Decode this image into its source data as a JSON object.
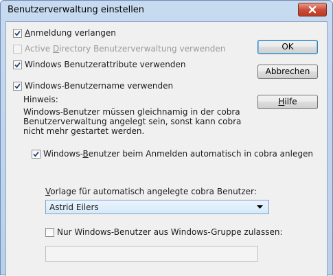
{
  "window": {
    "title": "Benutzerverwaltung einstellen"
  },
  "checkboxes": {
    "anmeldung": {
      "pre": "",
      "accel": "A",
      "post": "nmeldung verlangen",
      "checked": true
    },
    "active_directory": {
      "pre": "Active ",
      "accel": "D",
      "post": "irectory Benutzerverwaltung verwenden",
      "checked": false,
      "disabled": true
    },
    "attribute": {
      "label": "Windows Benutzerattribute verwenden",
      "checked": true
    },
    "benutzername": {
      "label": "Windows-Benutzername verwenden",
      "checked": true
    },
    "auto_anlegen": {
      "pre": "Windows-",
      "accel": "B",
      "post": "enutzer beim Anmelden automatisch in cobra anlegen",
      "checked": true
    },
    "gruppe": {
      "label": "Nur Windows-Benutzer aus Windows-Gruppe zulassen:",
      "checked": false
    }
  },
  "buttons": {
    "ok": "OK",
    "cancel": "Abbrechen",
    "help_accel": "H",
    "help_rest": "ilfe"
  },
  "hint": {
    "label": "Hinweis:",
    "line1": "Windows-Benutzer müssen gleichnamig in der cobra",
    "line2": "Benutzerverwaltung angelegt sein, sonst kann cobra",
    "line3": "nicht mehr gestartet werden."
  },
  "template": {
    "label_accel": "V",
    "label_rest": "orlage für automatisch angelegte cobra Benutzer:",
    "selected": "Astrid Eilers"
  },
  "group_input": {
    "value": ""
  },
  "colors": {
    "title_gradient_top": "#c7daf0",
    "close_button": "#c94a35",
    "dialog_bg": "#f0f0f0"
  }
}
